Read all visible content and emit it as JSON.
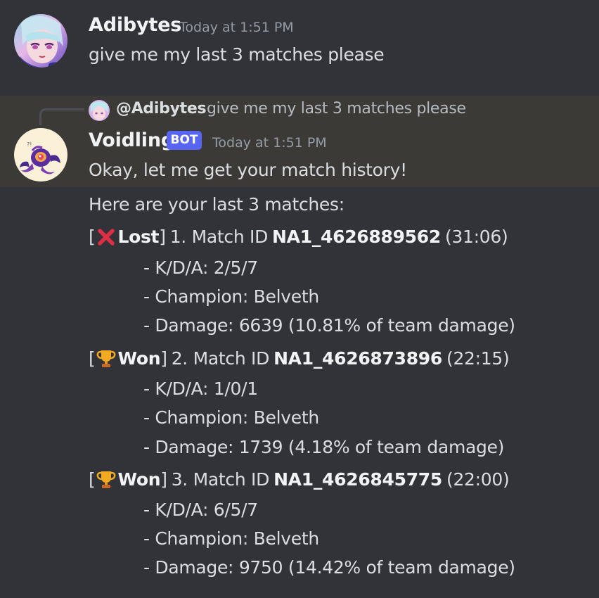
{
  "messages": {
    "first": {
      "author": "Adibytes",
      "timestamp": "Today at 1:51 PM",
      "text": "give me my last 3 matches please",
      "avatar_icon": "anime-girl-avatar"
    },
    "second": {
      "reply": {
        "author": "@Adibytes",
        "text": "give me my last 3 matches please"
      },
      "author": "Voidling",
      "badge": "BOT",
      "timestamp": "Today at 1:51 PM",
      "text": "Okay, let me get your match history!",
      "avatar_icon": "voidling-creature-avatar"
    },
    "third": {
      "intro": "Here are your last 3 matches:",
      "matches": [
        {
          "status_icon": "cross-mark-icon",
          "status": "Lost",
          "prefix": "1. Match ID",
          "match_id": "NA1_4626889562",
          "duration": "(31:06)",
          "kda": "- K/D/A: 2/5/7",
          "champion": "- Champion: Belveth",
          "damage": "- Damage: 6639 (10.81% of team damage)"
        },
        {
          "status_icon": "trophy-icon",
          "status": "Won",
          "prefix": "2. Match ID",
          "match_id": "NA1_4626873896",
          "duration": "(22:15)",
          "kda": "- K/D/A: 1/0/1",
          "champion": "- Champion: Belveth",
          "damage": "- Damage: 1739 (4.18% of team damage)"
        },
        {
          "status_icon": "trophy-icon",
          "status": "Won",
          "prefix": "3. Match ID",
          "match_id": "NA1_4626845775",
          "duration": "(22:00)",
          "kda": "- K/D/A: 6/5/7",
          "champion": "- Champion: Belveth",
          "damage": "- Damage: 9750 (14.42% of team damage)"
        }
      ]
    }
  },
  "colors": {
    "background": "#313338",
    "highlight": "#3c3a36",
    "bot_badge": "#5865f2",
    "text": "#dbdee1",
    "muted": "#949ba4"
  }
}
